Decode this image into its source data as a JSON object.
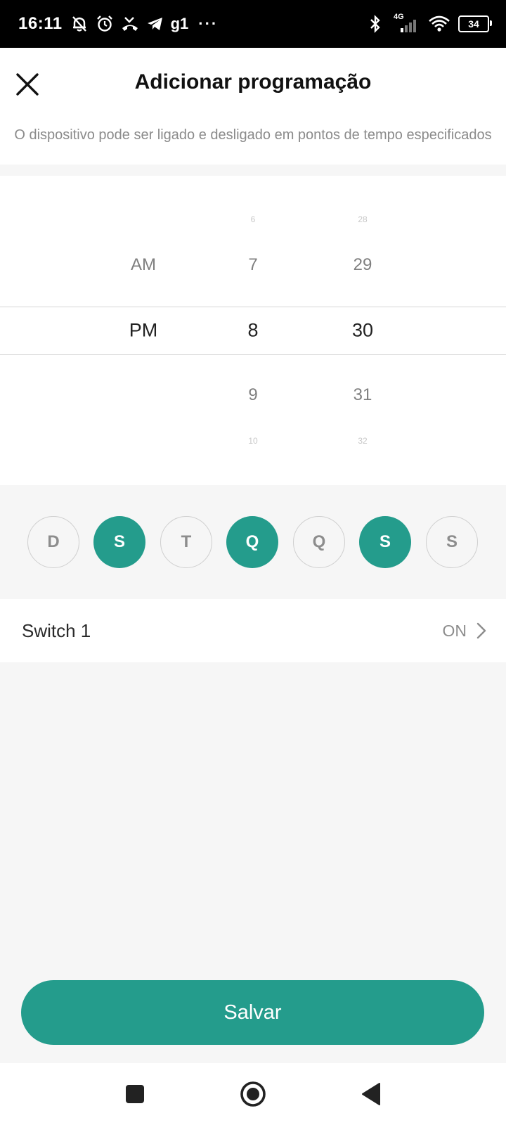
{
  "status_bar": {
    "time": "16:11",
    "app_text": "g1",
    "more": "···",
    "network": "4G",
    "battery": "34",
    "icons": [
      "notifications-off-icon",
      "alarm-icon",
      "missed-call-icon",
      "telegram-icon",
      "bluetooth-icon",
      "signal-icon",
      "wifi-icon",
      "battery-icon"
    ]
  },
  "header": {
    "title": "Adicionar programação",
    "subtitle": "O dispositivo pode ser ligado e desligado em pontos de tempo especificados",
    "close_icon": "close-icon"
  },
  "picker": {
    "ampm": {
      "options": [
        "AM",
        "PM"
      ],
      "selected": "PM"
    },
    "hours": {
      "visible": [
        "6",
        "7",
        "8",
        "9",
        "10"
      ],
      "selected": "8"
    },
    "minutes": {
      "visible": [
        "28",
        "29",
        "30",
        "31",
        "32"
      ],
      "selected": "30"
    }
  },
  "days": [
    {
      "label": "D",
      "selected": false
    },
    {
      "label": "S",
      "selected": true
    },
    {
      "label": "T",
      "selected": false
    },
    {
      "label": "Q",
      "selected": true
    },
    {
      "label": "Q",
      "selected": false
    },
    {
      "label": "S",
      "selected": true
    },
    {
      "label": "S",
      "selected": false
    }
  ],
  "switch_row": {
    "label": "Switch 1",
    "value": "ON",
    "icon": "chevron-right-icon"
  },
  "save_button": {
    "label": "Salvar"
  },
  "navbar": {
    "icons": [
      "recents-square-icon",
      "home-circle-icon",
      "back-triangle-icon"
    ]
  },
  "colors": {
    "accent": "#249c8c",
    "background": "#f6f6f6",
    "muted_text": "#8d8d8d"
  }
}
